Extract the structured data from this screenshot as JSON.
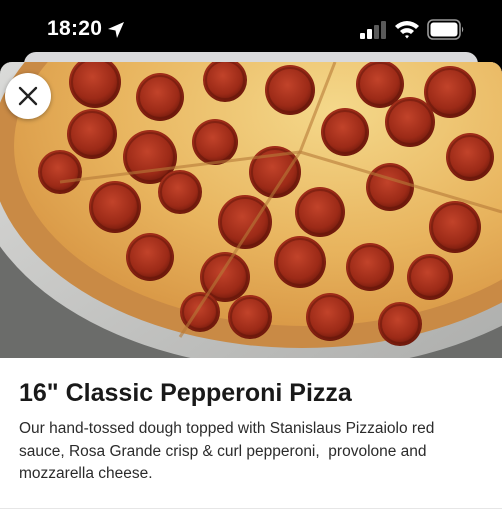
{
  "status_bar": {
    "time": "18:20",
    "icons": [
      "location-arrow-icon",
      "cellular-signal-icon",
      "wifi-icon",
      "battery-icon"
    ]
  },
  "item": {
    "image": "pepperoni-pizza-photo",
    "title": "16\" Classic Pepperoni Pizza",
    "description": "Our hand-tossed dough topped with Stanislaus Pizzaiolo red sauce, Rosa Grande crisp & curl pepperoni,  provolone and mozzarella cheese."
  },
  "controls": {
    "close_icon": "close-icon"
  },
  "colors": {
    "status_bar_bg": "#000000",
    "sheet_bg": "#ffffff",
    "title_text": "#191919",
    "body_text": "#2b2b2b"
  }
}
